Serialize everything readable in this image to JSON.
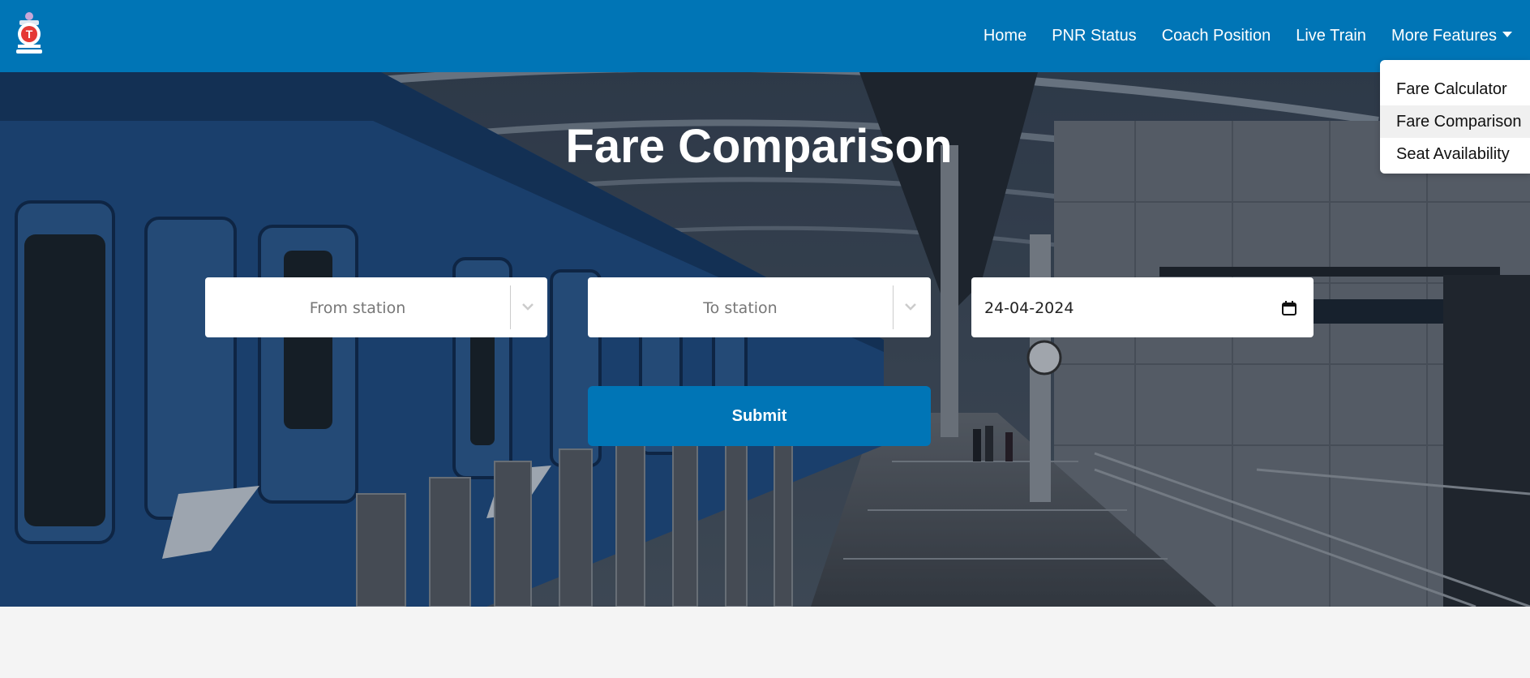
{
  "navbar": {
    "links": [
      {
        "label": "Home"
      },
      {
        "label": "PNR Status"
      },
      {
        "label": "Coach Position"
      },
      {
        "label": "Live Train"
      }
    ],
    "more_label": "More Features",
    "dropdown": [
      {
        "label": "Fare Calculator"
      },
      {
        "label": "Fare Comparison"
      },
      {
        "label": "Seat Availability"
      }
    ]
  },
  "hero": {
    "title": "Fare Comparison",
    "from_placeholder": "From station",
    "to_placeholder": "To station",
    "date_value": "24-04-2024",
    "submit_label": "Submit"
  },
  "colors": {
    "brand": "#0075b6",
    "page_background": "#f4f4f4"
  },
  "icons": [
    "train-logo-icon",
    "chevron-down-icon",
    "calendar-icon",
    "caret-down-icon"
  ]
}
